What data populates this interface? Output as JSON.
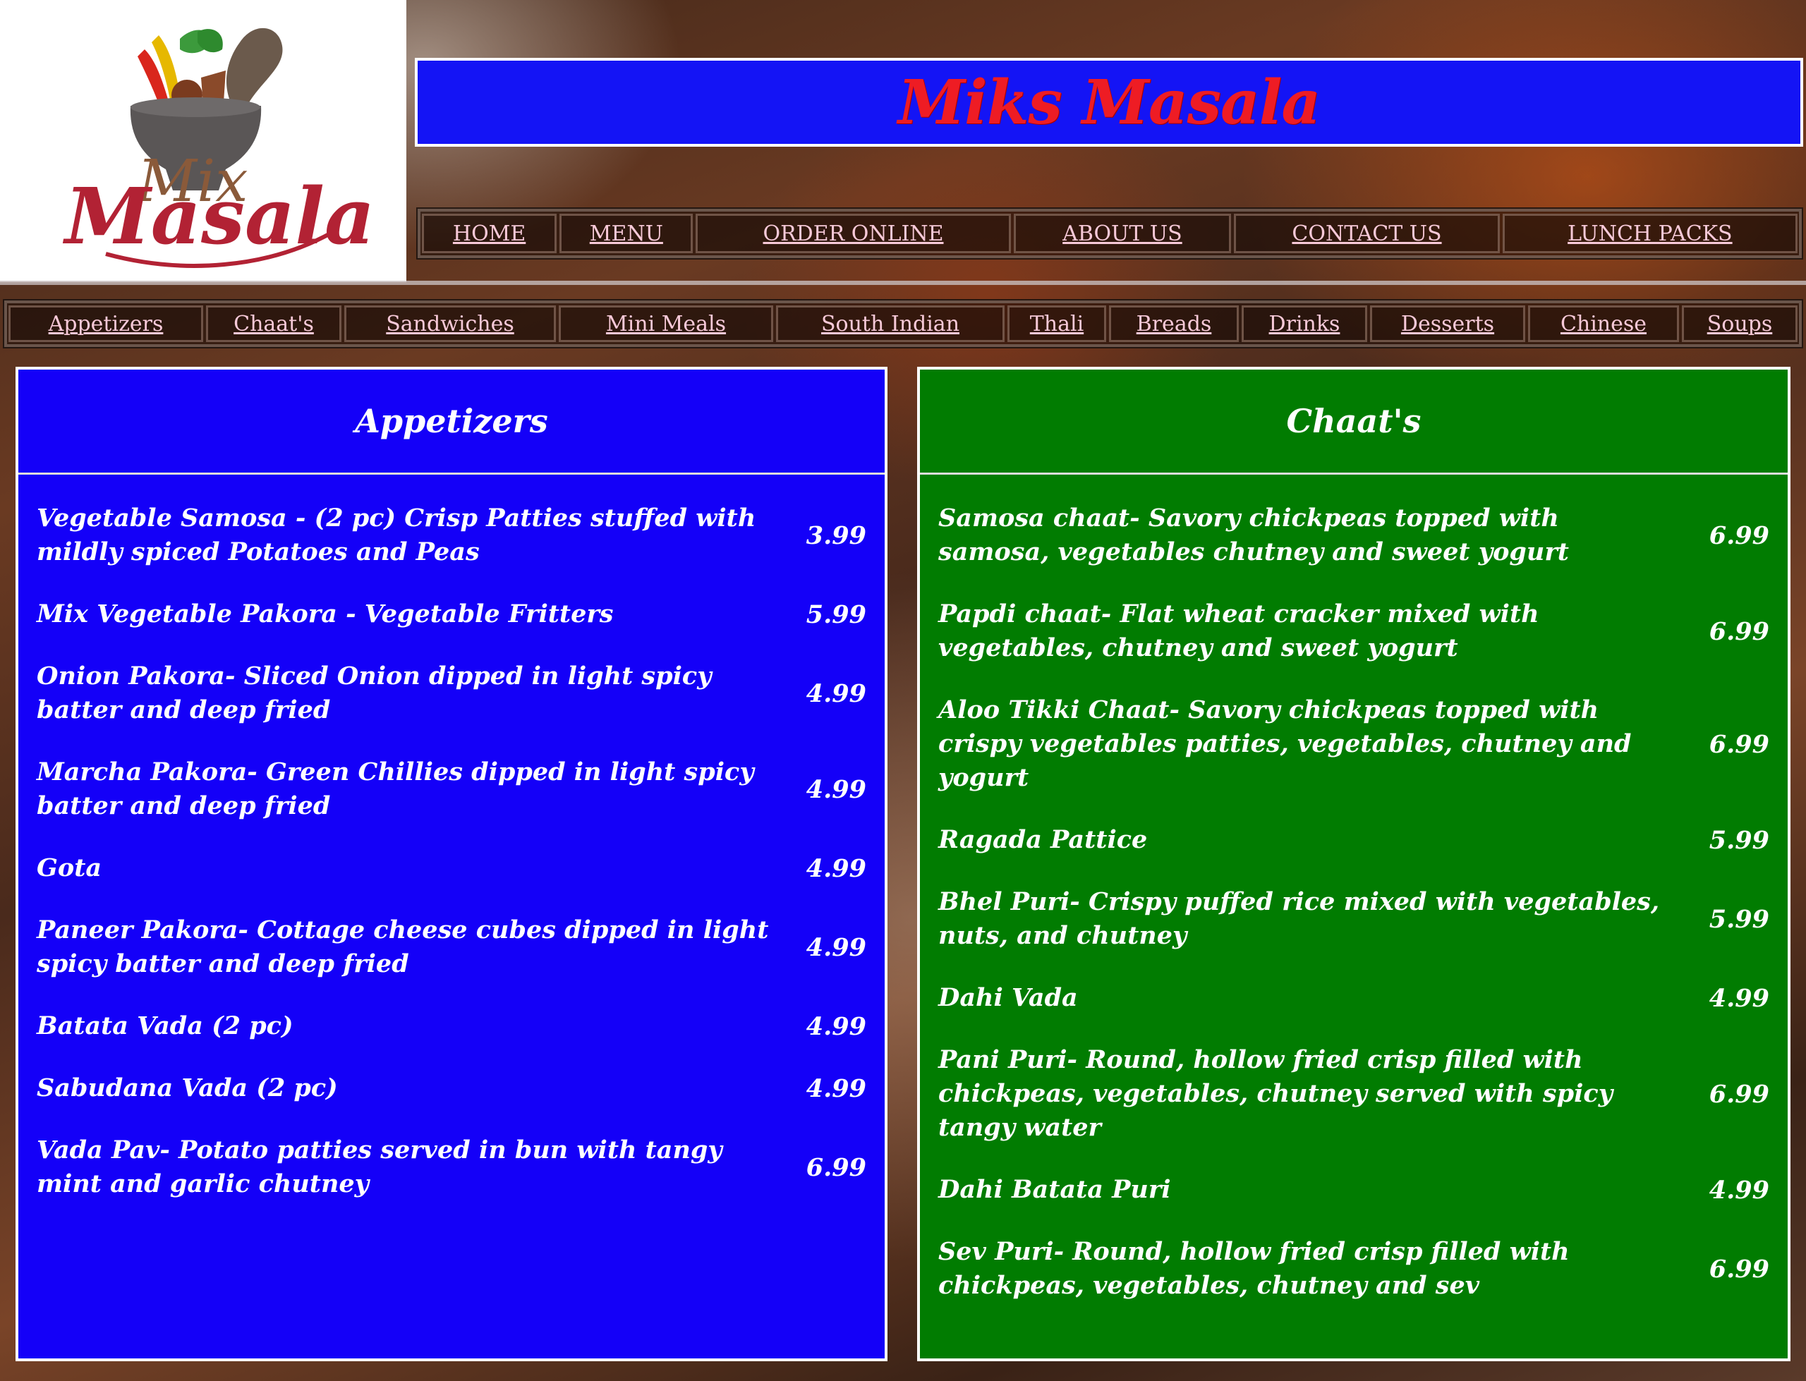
{
  "logo": {
    "line1": "Mix",
    "line2": "Masala"
  },
  "site_title": "Miks Masala",
  "main_nav": [
    "HOME",
    "MENU",
    "ORDER ONLINE",
    "ABOUT US",
    "CONTACT US",
    "LUNCH PACKS"
  ],
  "category_nav": [
    "Appetizers",
    "Chaat's",
    "Sandwiches",
    "Mini Meals",
    "South Indian",
    "Thali",
    "Breads",
    "Drinks",
    "Desserts",
    "Chinese",
    "Soups"
  ],
  "appetizers": {
    "title": "Appetizers",
    "items": [
      {
        "desc": "Vegetable Samosa - (2 pc) Crisp Patties stuffed with mildly spiced Potatoes and Peas",
        "price": "3.99"
      },
      {
        "desc": "Mix Vegetable Pakora - Vegetable Fritters",
        "price": "5.99"
      },
      {
        "desc": "Onion Pakora- Sliced Onion dipped in light spicy batter and deep fried",
        "price": "4.99"
      },
      {
        "desc": "Marcha Pakora- Green Chillies dipped in light spicy batter and deep fried",
        "price": "4.99"
      },
      {
        "desc": "Gota",
        "price": "4.99"
      },
      {
        "desc": "Paneer Pakora- Cottage cheese cubes dipped in light spicy batter and deep fried",
        "price": "4.99"
      },
      {
        "desc": "Batata Vada (2 pc)",
        "price": "4.99"
      },
      {
        "desc": "Sabudana Vada (2 pc)",
        "price": "4.99"
      },
      {
        "desc": "Vada Pav- Potato patties served in bun with tangy mint and garlic chutney",
        "price": "6.99"
      }
    ]
  },
  "chaats": {
    "title": "Chaat's",
    "items": [
      {
        "desc": "Samosa chaat- Savory chickpeas topped with samosa, vegetables chutney and sweet yogurt",
        "price": "6.99"
      },
      {
        "desc": "Papdi chaat- Flat wheat cracker mixed with vegetables, chutney and sweet yogurt",
        "price": "6.99"
      },
      {
        "desc": "Aloo Tikki Chaat- Savory chickpeas topped with crispy vegetables patties, vegetables, chutney and yogurt",
        "price": "6.99"
      },
      {
        "desc": "Ragada Pattice",
        "price": "5.99"
      },
      {
        "desc": "Bhel Puri- Crispy puffed rice mixed with vegetables, nuts, and chutney",
        "price": "5.99"
      },
      {
        "desc": "Dahi Vada",
        "price": "4.99"
      },
      {
        "desc": "Pani Puri- Round, hollow fried crisp filled with chickpeas, vegetables, chutney served with spicy tangy water",
        "price": "6.99"
      },
      {
        "desc": "Dahi Batata Puri",
        "price": "4.99"
      },
      {
        "desc": "Sev Puri- Round, hollow fried crisp filled with chickpeas, vegetables, chutney and sev",
        "price": "6.99"
      }
    ]
  },
  "colors": {
    "title_bg": "#1414f5",
    "title_text": "#ee1c24",
    "blue_panel": "#1400f8",
    "green_panel": "#017c01",
    "nav_link": "#f7c9d8"
  }
}
